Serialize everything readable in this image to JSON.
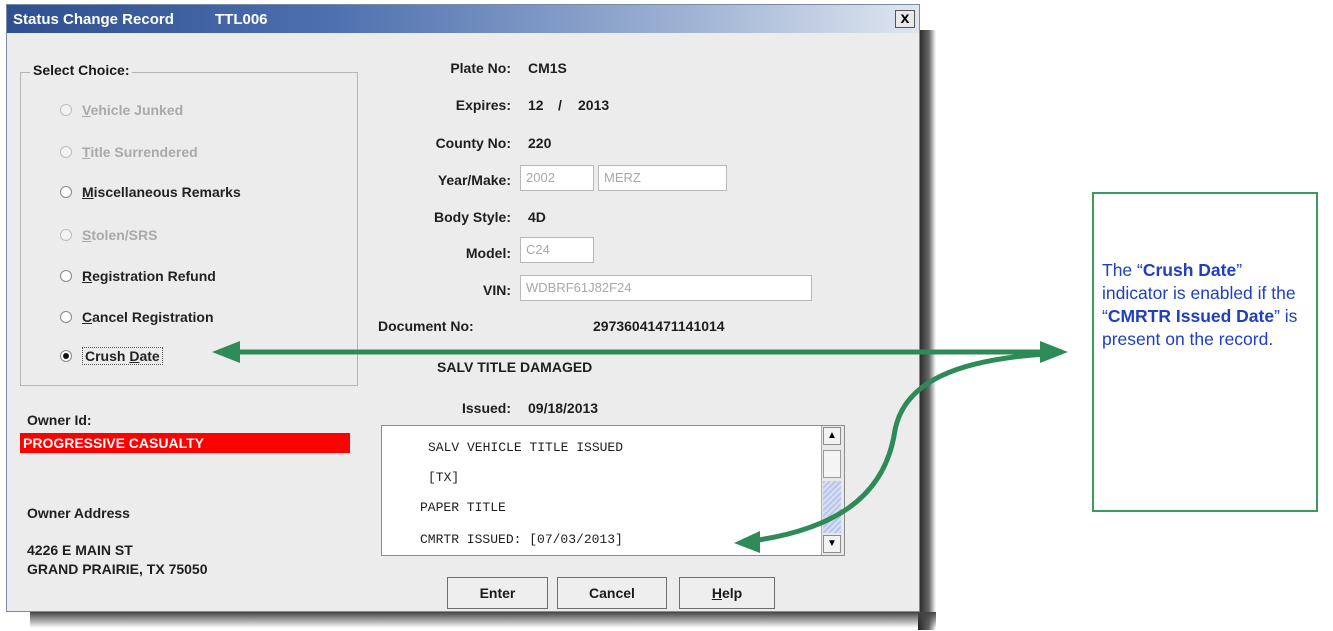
{
  "window": {
    "title": "Status Change Record",
    "code": "TTL006",
    "close_label": "x"
  },
  "choices": {
    "group_label": "Select Choice:",
    "items": [
      {
        "label": "Vehicle Junked",
        "mnemonic": "V",
        "rest": "ehicle Junked",
        "enabled": false,
        "selected": false
      },
      {
        "label": "Title Surrendered",
        "mnemonic": "T",
        "rest": "itle Surrendered",
        "enabled": false,
        "selected": false
      },
      {
        "label": "Miscellaneous Remarks",
        "mnemonic": "M",
        "rest": "iscellaneous Remarks",
        "enabled": true,
        "selected": false
      },
      {
        "label": "Stolen/SRS",
        "mnemonic": "S",
        "rest": "tolen/SRS",
        "enabled": false,
        "selected": false
      },
      {
        "label": "Registration Refund",
        "mnemonic": "R",
        "rest": "egistration Refund",
        "enabled": true,
        "selected": false
      },
      {
        "label": "Cancel Registration",
        "mnemonic": "C",
        "rest": "ancel Registration",
        "enabled": true,
        "selected": false
      },
      {
        "label": "Crush Date",
        "pre": "Crush ",
        "mnemonic": "D",
        "rest": "ate",
        "enabled": true,
        "selected": true
      }
    ]
  },
  "vehicle": {
    "plate_label": "Plate No:",
    "plate_value": "CM1S",
    "expires_label": "Expires:",
    "expires_month": "12",
    "expires_sep": "/",
    "expires_year": "2013",
    "county_label": "County No:",
    "county_value": "220",
    "yearmake_label": "Year/Make:",
    "year_value": "2002",
    "make_value": "MERZ",
    "body_label": "Body Style:",
    "body_value": "4D",
    "model_label": "Model:",
    "model_value": "C24",
    "vin_label": "VIN:",
    "vin_value": "WDBRF61J82F24",
    "document_label": "Document No:",
    "document_value": "29736041471141014",
    "title_type": "SALV TITLE DAMAGED",
    "issued_label": "Issued:",
    "issued_value": "09/18/2013"
  },
  "remarks": {
    "lines": [
      "SALV VEHICLE TITLE ISSUED",
      "[TX]",
      "PAPER TITLE",
      "CMRTR ISSUED:  [07/03/2013]"
    ]
  },
  "owner": {
    "id_label": "Owner Id:",
    "name": "PROGRESSIVE CASUALTY",
    "address_label": "Owner Address",
    "address_line1": "4226 E MAIN ST",
    "address_line2": "GRAND PRAIRIE, TX 75050"
  },
  "buttons": {
    "enter": "Enter",
    "cancel": "Cancel",
    "help_mnemonic": "H",
    "help_rest": "elp"
  },
  "callout": {
    "t1": "The “",
    "b1": "Crush Date",
    "t2": "” indicator is enabled if the “",
    "b2": "CMRTR Issued Date",
    "t3": "” is present on the record."
  },
  "colors": {
    "owner_highlight": "#ff0000",
    "arrow": "#2e8b57",
    "callout_text": "#1f3fbf",
    "title_bar": "#2f4f8f"
  }
}
